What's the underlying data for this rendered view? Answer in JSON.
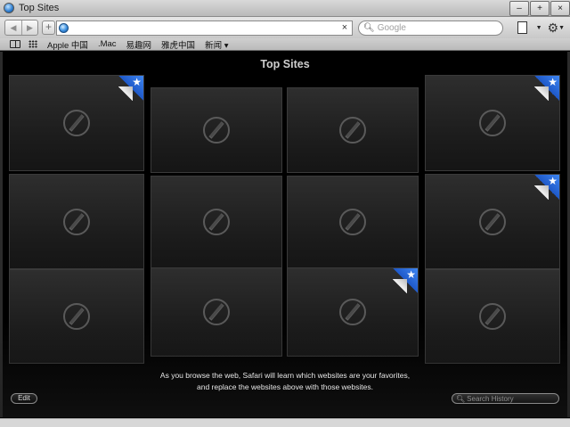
{
  "window": {
    "title": "Top Sites",
    "controls": {
      "minimize": "–",
      "maximize": "+",
      "close": "×"
    }
  },
  "toolbar": {
    "back": "◀",
    "forward": "▶",
    "add": "+",
    "url_value": "",
    "clear": "×",
    "search_placeholder": "Google",
    "search_glyph": "🔍︎",
    "page_menu_caret": "▼",
    "settings_glyph": "⚙",
    "settings_caret": "▼"
  },
  "bookmarks": {
    "items": [
      "Apple 中国",
      ".Mac",
      "易趣网",
      "雅虎中国",
      "新闻 ▾"
    ]
  },
  "main": {
    "title": "Top Sites",
    "message_line1": "As you browse the web, Safari will learn which websites are your favorites,",
    "message_line2": "and replace the websites above with those websites.",
    "edit_label": "Edit",
    "history_placeholder": "Search History",
    "history_glyph": "🔍︎",
    "pin_glyph": "★"
  },
  "tiles": [
    {
      "pinned": true
    },
    {
      "pinned": false
    },
    {
      "pinned": false
    },
    {
      "pinned": true
    },
    {
      "pinned": false
    },
    {
      "pinned": false
    },
    {
      "pinned": false
    },
    {
      "pinned": true
    },
    {
      "pinned": false
    },
    {
      "pinned": false
    },
    {
      "pinned": true
    },
    {
      "pinned": false
    }
  ],
  "colors": {
    "background": "#000000",
    "pin_blue": "#2c6be0",
    "chrome": "#c8c8c8"
  }
}
